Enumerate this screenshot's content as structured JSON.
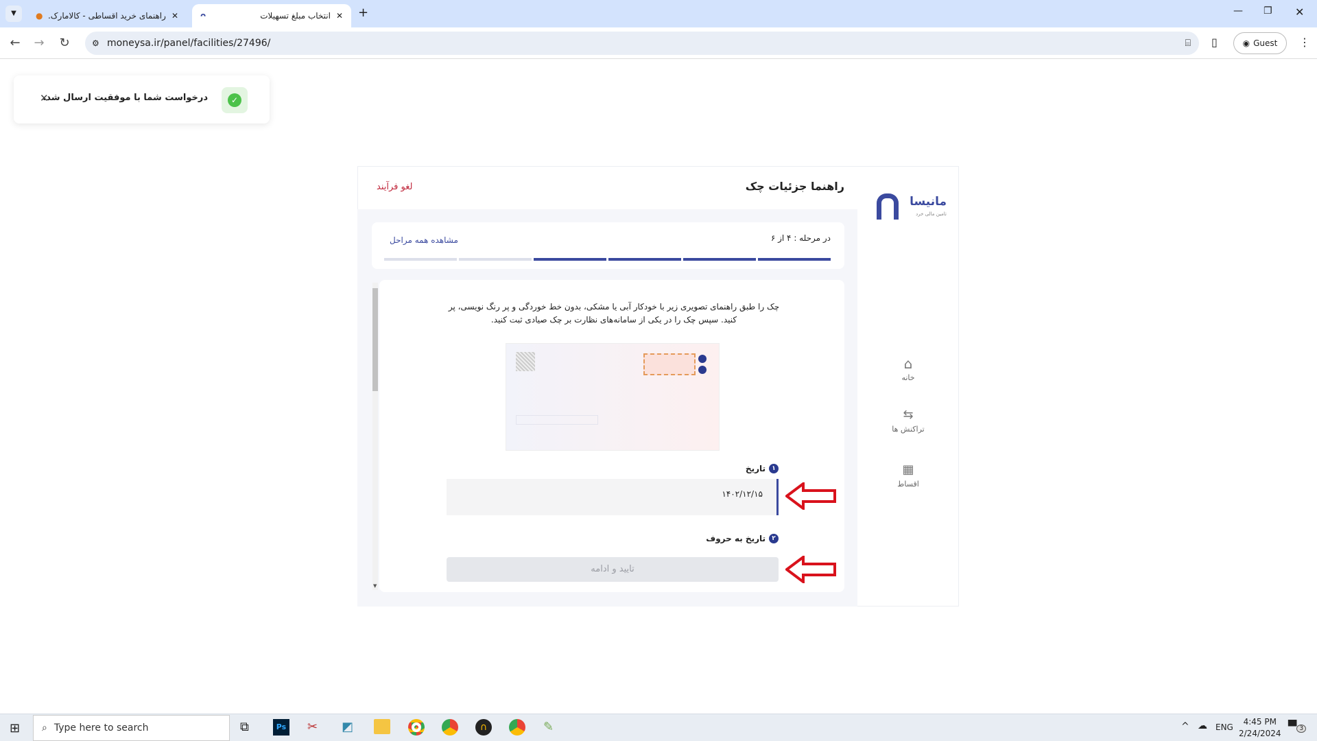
{
  "browser": {
    "tabs": [
      {
        "title": "راهنمای خرید اقساطی - کالامارک...",
        "active": false
      },
      {
        "title": "انتخاب مبلغ تسهیلات",
        "active": true
      }
    ],
    "url": "moneysa.ir/panel/facilities/27496/",
    "profile": "Guest"
  },
  "toast": {
    "message": "درخواست شما با موفقیت ارسال شد.",
    "status_color": "#4cc24a"
  },
  "app": {
    "logo_text": "مانیسا",
    "logo_tagline": "تامین مالی خرد",
    "brand_color": "#3b4a9f",
    "header_title": "راهنما جزئیات چک",
    "cancel_label": "لغو فرآیند",
    "cancel_color": "#c0283c",
    "progress": {
      "label": "در مرحله : ۴ از ۶",
      "current": 4,
      "total": 6,
      "view_all": "مشاهده همه مراحل"
    },
    "instructions_line1": "چک را طبق راهنمای تصویری زیر با خودکار آبی یا مشکی، بدون خط خوردگی و پر رنگ نویسی، پر",
    "instructions_line2": "کنید. سپس چک را در یکی از سامانه‌های نظارت بر چک صیادی ثبت کنید.",
    "field1": {
      "badge": "۱",
      "label": "تاریخ",
      "value": "۱۴۰۲/۱۲/۱۵"
    },
    "field2": {
      "badge": "۲",
      "label": "تاریخ به حروف"
    },
    "submit_label": "تایید و ادامه",
    "nav": [
      {
        "label": "خانه",
        "icon": "home-icon"
      },
      {
        "label": "تراکنش ها",
        "icon": "transactions-icon"
      },
      {
        "label": "اقساط",
        "icon": "calendar-icon"
      }
    ]
  },
  "taskbar": {
    "search_placeholder": "Type here to search",
    "lang": "ENG",
    "time": "4:45 PM",
    "date": "2/24/2024",
    "notifications": "3"
  }
}
